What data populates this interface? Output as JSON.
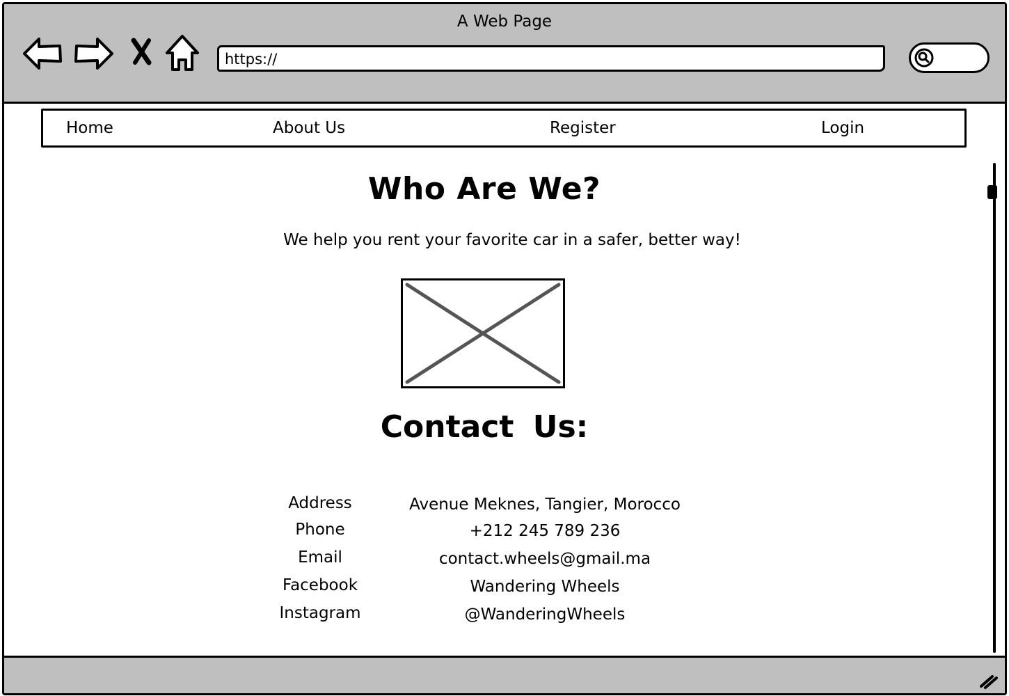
{
  "window": {
    "title": "A Web Page"
  },
  "toolbar": {
    "back_icon": "arrow-left-icon",
    "forward_icon": "arrow-right-icon",
    "stop_icon": "close-icon",
    "home_icon": "home-icon",
    "search_icon": "search-icon"
  },
  "address_bar": {
    "value": "https://"
  },
  "menu": {
    "items": [
      {
        "label": "Home"
      },
      {
        "label": "About Us"
      },
      {
        "label": "Register"
      },
      {
        "label": "Login"
      }
    ]
  },
  "about": {
    "heading": "Who Are We?",
    "tagline": "We help you rent your favorite car in a safer, better way!",
    "image_icon": "image-placeholder-icon"
  },
  "contact": {
    "heading": "Contact  Us:",
    "rows": [
      {
        "label": "Address",
        "value": "Avenue Meknes, Tangier, Morocco"
      },
      {
        "label": "Phone",
        "value": "+212 245 789 236"
      },
      {
        "label": "Email",
        "value": "contact.wheels@gmail.ma"
      },
      {
        "label": "Facebook",
        "value": "Wandering Wheels"
      },
      {
        "label": "Instagram",
        "value": "@WanderingWheels"
      }
    ]
  },
  "colors": {
    "chrome_gray": "#bfbfbf",
    "outline": "#000000",
    "placeholder_cross": "#555555"
  }
}
